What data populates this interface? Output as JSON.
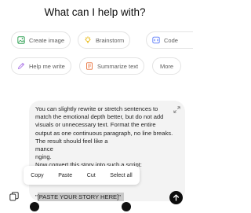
{
  "heading": "What can I help with?",
  "suggestions": {
    "create_image": "Create image",
    "brainstorm": "Brainstorm",
    "code": "Code",
    "help_me_write": "Help me write",
    "summarize_text": "Summarize text",
    "more": "More"
  },
  "composer": {
    "text": "You can slightly rewrite or stretch sentences to match the emotional depth better, but do not add visuals or unnecessary text. Format the entire output as one continuous paragraph, no line breaks. The result should feel like a\nmance\nnging.\nNow convert this story into such a script:",
    "selected_text": "\"[PASTE YOUR STORY HERE]\""
  },
  "context_menu": {
    "copy": "Copy",
    "paste": "Paste",
    "cut": "Cut",
    "select_all": "Select all"
  },
  "colors": {
    "create_image": "#3aa65c",
    "brainstorm": "#e8b400",
    "code": "#5c7cfa",
    "help_me_write": "#b07ce8",
    "summarize_text": "#e8703a",
    "send": "#0d0d0d"
  },
  "icons": {
    "create_image": "image-icon",
    "brainstorm": "lightbulb-icon",
    "code": "code-icon",
    "help_me_write": "pen-icon",
    "summarize_text": "document-icon",
    "attach": "attach-icon",
    "send": "arrow-up-icon",
    "expand": "expand-icon"
  }
}
